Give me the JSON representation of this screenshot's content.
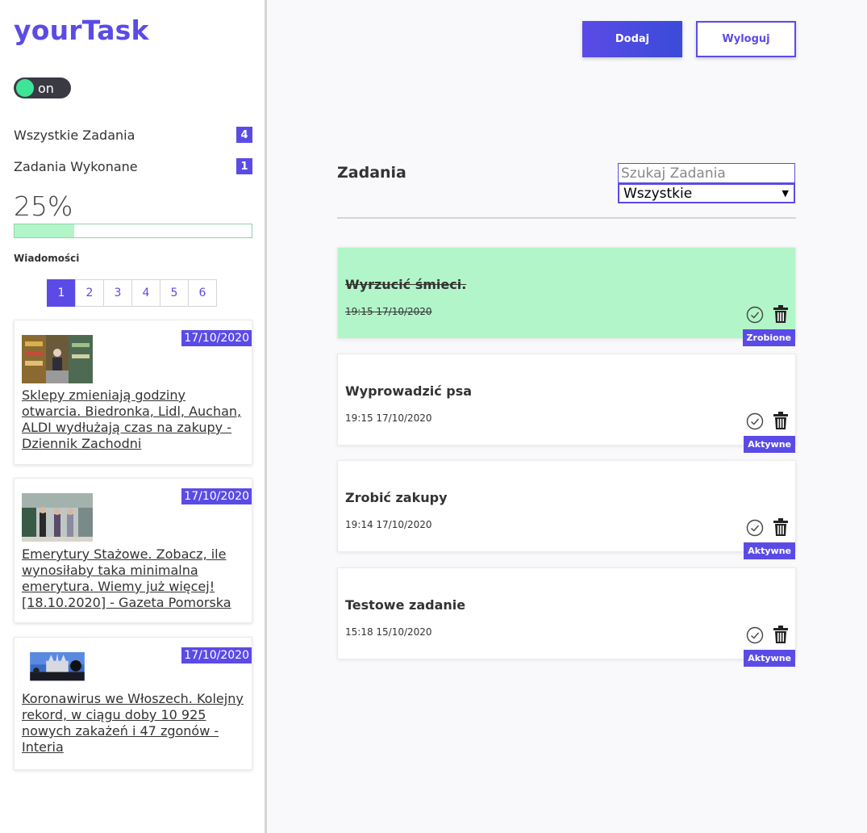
{
  "app": {
    "logo": "yourTask"
  },
  "sidebar": {
    "toggle_label": "on",
    "stats": [
      {
        "label": "Wszystkie Zadania",
        "count": "4"
      },
      {
        "label": "Zadania Wykonane",
        "count": "1"
      }
    ],
    "percent": "25%",
    "progress_fraction": 0.25,
    "messages_label": "Wiadomości",
    "pages": [
      "1",
      "2",
      "3",
      "4",
      "5",
      "6"
    ],
    "active_page": "1",
    "news": [
      {
        "date": "17/10/2020",
        "title": "Sklepy zmieniają godziny otwarcia. Biedronka, Lidl, Auchan, ALDI wydłużają czas na zakupy - Dziennik Zachodni"
      },
      {
        "date": "17/10/2020",
        "title": "Emerytury Stażowe. Zobacz, ile wynosiłaby taka minimalna emerytura. Wiemy już więcej! [18.10.2020] - Gazeta Pomorska"
      },
      {
        "date": "17/10/2020",
        "title": "Koronawirus we Włoszech. Kolejny rekord, w ciągu doby 10 925 nowych zakażeń i 47 zgonów - Interia"
      }
    ]
  },
  "header": {
    "add_label": "Dodaj",
    "logout_label": "Wyloguj"
  },
  "main": {
    "heading": "Zadania",
    "search_placeholder": "Szukaj Zadania",
    "filter_value": "Wszystkie",
    "tasks": [
      {
        "title": "Wyrzucić śmieci.",
        "time": "19:15 17/10/2020",
        "status": "Zrobione",
        "done": true
      },
      {
        "title": "Wyprowadzić psa",
        "time": "19:15 17/10/2020",
        "status": "Aktywne",
        "done": false
      },
      {
        "title": "Zrobić zakupy",
        "time": "19:14 17/10/2020",
        "status": "Aktywne",
        "done": false
      },
      {
        "title": "Testowe zadanie",
        "time": "15:18 15/10/2020",
        "status": "Aktywne",
        "done": false
      }
    ]
  },
  "colors": {
    "accent": "#5b4be6",
    "done_bg": "#b2f5c8",
    "toggle_knob": "#3ee596"
  },
  "icons": {
    "check": "check-circle-icon",
    "trash": "trash-icon"
  }
}
